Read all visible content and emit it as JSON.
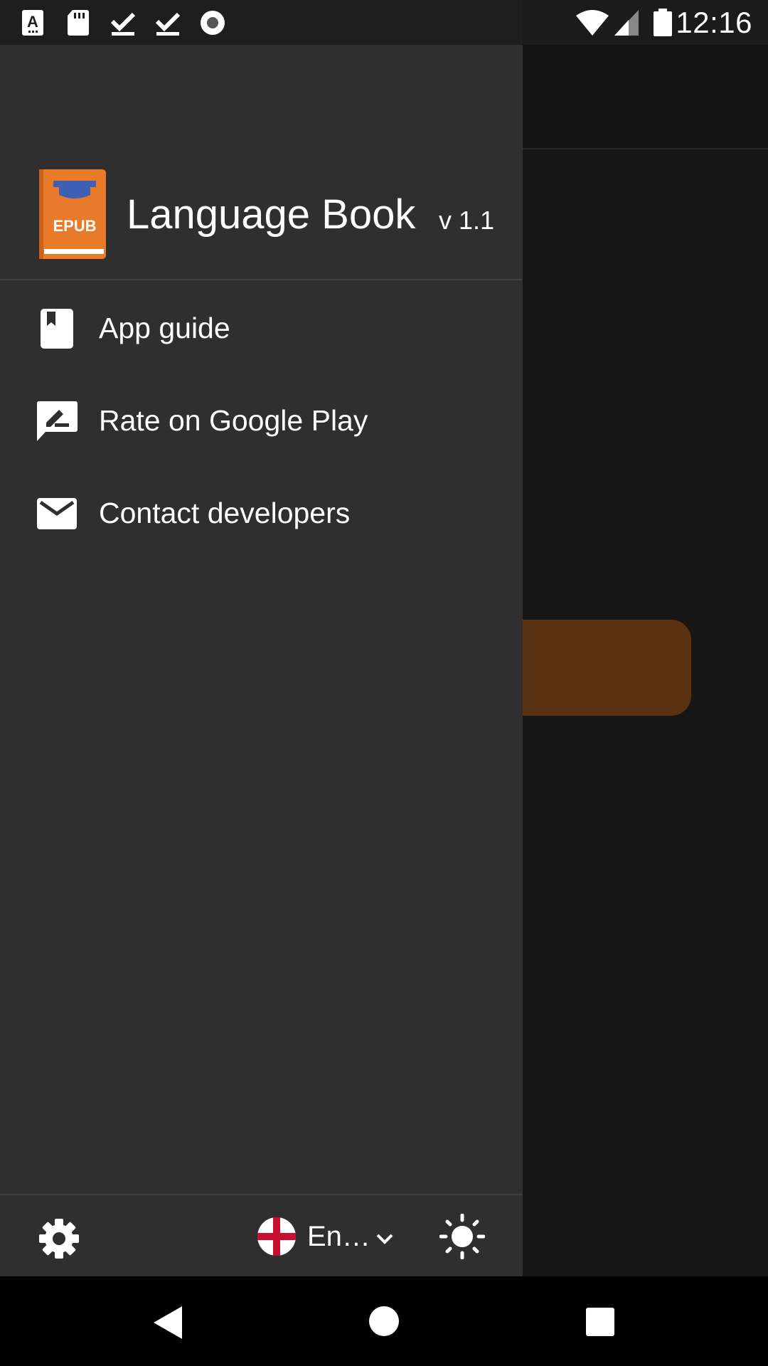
{
  "status_bar": {
    "time": "12:16",
    "left_icons": [
      "text-a-icon",
      "sd-card-icon",
      "download-done-icon",
      "download-done-icon",
      "record-icon"
    ],
    "right_icons": [
      "wifi-icon",
      "cell-signal-icon",
      "battery-icon"
    ]
  },
  "drawer": {
    "app_title": "Language Book",
    "version": "v 1.1",
    "logo_text": "EPUB",
    "menu": [
      {
        "label": "App guide",
        "icon": "book-icon"
      },
      {
        "label": "Rate on Google Play",
        "icon": "rate-review-icon"
      },
      {
        "label": "Contact developers",
        "icon": "mail-icon"
      }
    ],
    "footer": {
      "language_label": "En…",
      "language_flag": "england-flag-icon"
    }
  },
  "colors": {
    "drawer_bg": "#2f2f2f",
    "background_app": "#161616",
    "accent_button_dimmed": "#5a3211",
    "logo_orange": "#e87a2a",
    "logo_blue": "#3f5fb5"
  }
}
